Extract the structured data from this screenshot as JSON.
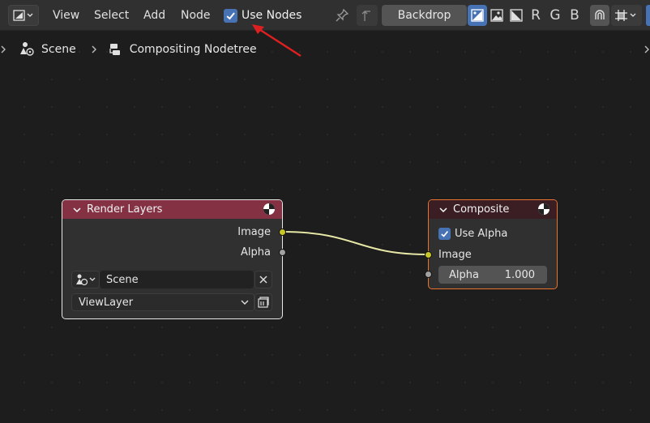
{
  "header": {
    "menus": [
      "View",
      "Select",
      "Add",
      "Node"
    ],
    "use_nodes_label": "Use Nodes",
    "backdrop_label": "Backdrop",
    "channels": [
      "R",
      "G",
      "B"
    ]
  },
  "breadcrumb": {
    "items": [
      "Scene",
      "Compositing Nodetree"
    ]
  },
  "render_layers": {
    "title": "Render Layers",
    "outputs": [
      "Image",
      "Alpha"
    ],
    "scene_value": "Scene",
    "view_layer_value": "ViewLayer"
  },
  "composite": {
    "title": "Composite",
    "use_alpha_label": "Use Alpha",
    "image_input": "Image",
    "alpha_label": "Alpha",
    "alpha_value": "1.000"
  },
  "colors": {
    "render_layers_header": "#833143",
    "composite_header": "#3a1e24",
    "composite_border": "#e7732e",
    "image_socket": "#c7c729",
    "value_socket": "#a1a1a1",
    "link": "#e6e6a6",
    "accent": "#4772b3",
    "annotation_arrow": "#e02020"
  }
}
